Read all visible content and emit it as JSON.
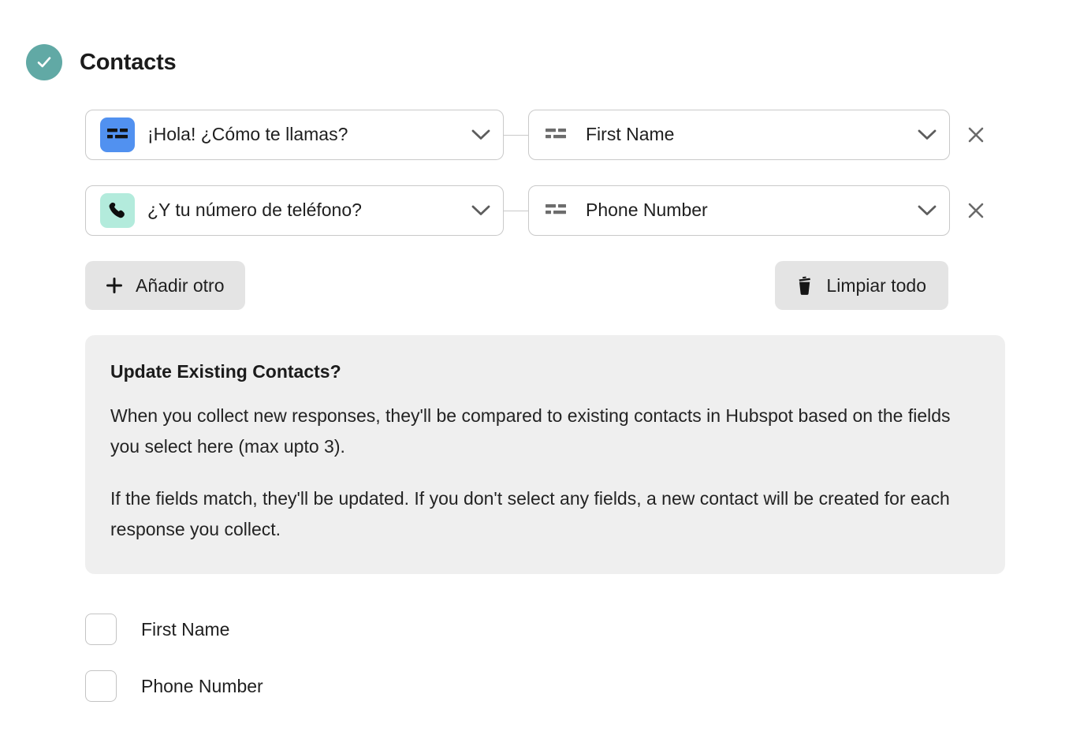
{
  "header": {
    "title": "Contacts",
    "status_icon": "check-circle-icon",
    "accent_color": "#61a9a5"
  },
  "mappings": {
    "rows": [
      {
        "source": {
          "label": "¡Hola! ¿Cómo te llamas?",
          "icon": "short-text-icon",
          "icon_bg": "#5191f0"
        },
        "target": {
          "label": "First Name",
          "icon": "short-text-icon"
        },
        "remove_icon": "close-icon"
      },
      {
        "source": {
          "label": "¿Y tu número de teléfono?",
          "icon": "phone-icon",
          "icon_bg": "#b3ebdc"
        },
        "target": {
          "label": "Phone Number",
          "icon": "short-text-icon"
        },
        "remove_icon": "close-icon"
      }
    ]
  },
  "actions": {
    "add_label": "Añadir otro",
    "add_icon": "plus-icon",
    "clear_label": "Limpiar todo",
    "clear_icon": "trash-icon"
  },
  "info": {
    "title": "Update Existing Contacts?",
    "paragraph1": "When you collect new responses, they'll be compared to existing contacts in Hubspot based on the fields you select here (max upto 3).",
    "paragraph2": "If the fields match, they'll be updated. If you don't select any fields, a new contact will be created for each response you collect."
  },
  "match_fields": {
    "items": [
      {
        "label": "First Name",
        "checked": false
      },
      {
        "label": "Phone Number",
        "checked": false
      }
    ]
  }
}
